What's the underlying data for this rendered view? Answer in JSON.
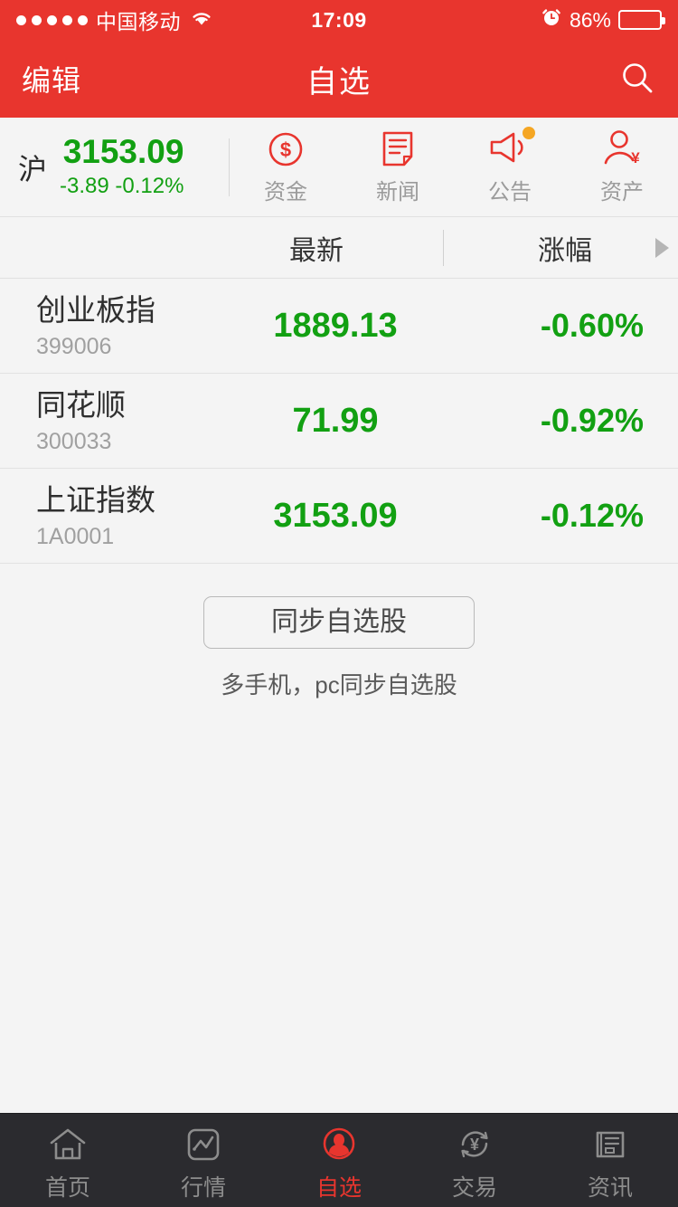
{
  "status_bar": {
    "carrier": "中国移动",
    "signal_dots": 5,
    "time": "17:09",
    "battery_pct_label": "86%",
    "battery_level": 86,
    "icons": [
      "wifi-icon",
      "alarm-clock-icon",
      "battery-icon"
    ]
  },
  "nav": {
    "edit_label": "编辑",
    "title": "自选",
    "search_icon": "search-icon"
  },
  "index": {
    "market_label": "沪",
    "price": "3153.09",
    "change": "-3.89",
    "change_pct": "-0.12%",
    "color": "#12a012"
  },
  "quick_actions": [
    {
      "label": "资金",
      "icon": "dollar-circle-icon",
      "badge": false
    },
    {
      "label": "新闻",
      "icon": "document-icon",
      "badge": false
    },
    {
      "label": "公告",
      "icon": "megaphone-icon",
      "badge": true
    },
    {
      "label": "资产",
      "icon": "person-yen-icon",
      "badge": false
    }
  ],
  "list_header": {
    "latest": "最新",
    "change_pct": "涨幅",
    "arrow_icon": "triangle-right-icon"
  },
  "stocks": [
    {
      "name": "创业板指",
      "code": "399006",
      "price": "1889.13",
      "change_pct": "-0.60%"
    },
    {
      "name": "同花顺",
      "code": "300033",
      "price": "71.99",
      "change_pct": "-0.92%"
    },
    {
      "name": "上证指数",
      "code": "1A0001",
      "price": "3153.09",
      "change_pct": "-0.12%"
    }
  ],
  "sync": {
    "button_label": "同步自选股",
    "subtitle": "多手机，pc同步自选股"
  },
  "tabs": [
    {
      "label": "首页",
      "icon": "home-icon",
      "active": false
    },
    {
      "label": "行情",
      "icon": "chart-icon",
      "active": false
    },
    {
      "label": "自选",
      "icon": "person-circle-icon",
      "active": true
    },
    {
      "label": "交易",
      "icon": "yen-refresh-icon",
      "active": false
    },
    {
      "label": "资讯",
      "icon": "newspaper-icon",
      "active": false
    }
  ],
  "colors": {
    "brand_red": "#e8352e",
    "down_green": "#12a012",
    "badge_orange": "#f5a623",
    "tabbar_dark": "#2b2b2f"
  }
}
